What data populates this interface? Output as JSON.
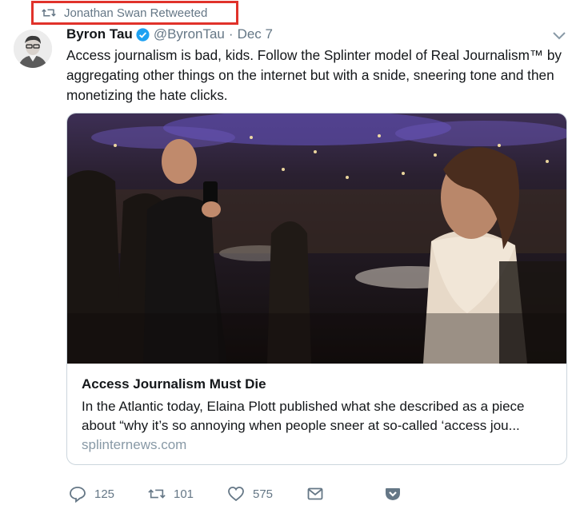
{
  "retweet": {
    "text": "Jonathan Swan Retweeted",
    "icon": "retweet-icon"
  },
  "tweet": {
    "author_name": "Byron Tau",
    "handle": "@ByronTau",
    "separator": "·",
    "date": "Dec 7",
    "verified": true,
    "text": "Access journalism is bad, kids. Follow the Splinter model of Real Journalism™ by aggregating other things on the internet but with a snide, sneering tone and then monetizing the hate clicks."
  },
  "card": {
    "title": "Access Journalism Must Die",
    "description": "In the Atlantic today, Elaina Plott published what she described as a piece about “why it’s so annoying when people sneer at so-called ‘access jou...",
    "domain": "splinternews.com"
  },
  "actions": {
    "replies": "125",
    "retweets": "101",
    "likes": "575"
  },
  "colors": {
    "accent": "#1da1f2",
    "muted": "#657786",
    "highlight_box": "#e0322a"
  }
}
